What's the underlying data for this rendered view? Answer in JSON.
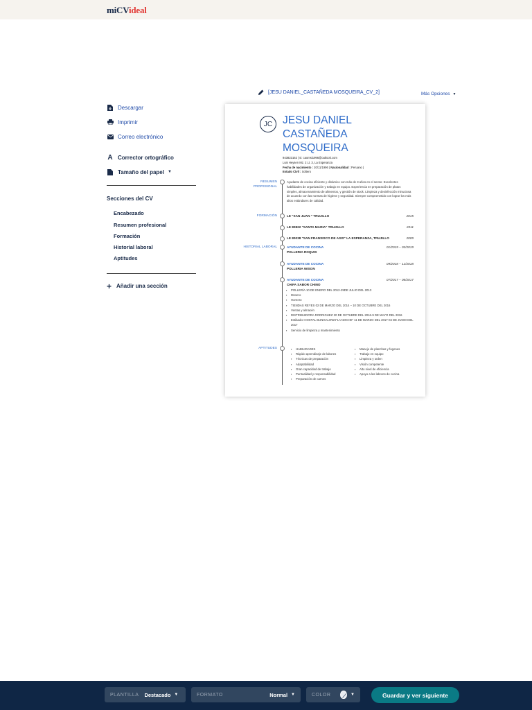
{
  "brand": {
    "logo_part1": "miCV",
    "logo_part2": "ideal"
  },
  "document": {
    "filename": "[JESU DANIEL_CASTAÑEDA MOSQUEIRA_CV_2]",
    "more_options": "Más Opciones"
  },
  "sidebar": {
    "actions": {
      "download": "Descargar",
      "print": "Imprimir",
      "email": "Correo electrónico",
      "spellcheck": "Corrector ortográfico",
      "paper_size": "Tamaño del papel"
    },
    "sections_title": "Secciones del CV",
    "sections": [
      "Encabezado",
      "Resumen profesional",
      "Formación",
      "Historial laboral",
      "Aptitudes"
    ],
    "add_section": "Añadir una sección"
  },
  "cv": {
    "initials": "JC",
    "name_line1": "JESU DANIEL",
    "name_line2": "CASTAÑEDA",
    "name_line3": "MOSQUEIRA",
    "contact": {
      "phone_email": "943823162 | E: caomsi1996@outlook.com",
      "address": "Luis Heysen Mz. 2 Lt. 3,  La Esperanza",
      "birth_label": "Fecha de nacimiento :",
      "birth_value": "20/11/1996 |",
      "nationality_label": "Nacionalidad :",
      "nationality_value": "Peruano |",
      "civil_label": "Estado Civil :",
      "civil_value": "Soltero"
    },
    "labels": {
      "summary": "RESUMEN PROFESIONAL",
      "education": "FORMACIÓN",
      "work": "HISTORIAL LABORAL",
      "skills": "APTITUDES"
    },
    "summary": "Ayudante de cocina eficiente y dinámico con más de 3 años en el sector. Excelentes habilidades de organización y trabajo en equipo. Experiencia en preparación de platos simples, almacenamiento de alimentos, y gestión de stock. Limpieza y desinfección minuciosa de acuerdo con las normas de higiene y seguridad. Siempre comprometido con lograr los más altos estándares de calidad.",
    "education": [
      {
        "title": "LE \"SAN JUAN \" TRUJILLO",
        "year": "2015"
      },
      {
        "title": "LE 80822 \"SANTA MARIA\" TRUJILLO",
        "year": "2011"
      },
      {
        "title": "LE 80038 \"SAN FRANSISCO DE ASIS\" LA ESPERANZA, TRUJILLO",
        "year": "2009"
      }
    ],
    "jobs": [
      {
        "title": "AYUDANTE DE COCINA",
        "company": "POLLERIA ROQUIS",
        "dates": "01/2019 – 03/2019"
      },
      {
        "title": "AYUDANTE DE COCINA",
        "company": "POLLERIA WISON",
        "dates": "09/2018 – 12/2018"
      },
      {
        "title": "AYUDANTE DE COCINA",
        "company": "CHIFA SABOR CHINO",
        "dates": "07/2017 – 08/2017"
      }
    ],
    "job_bullets": [
      "POLLERÍA 10 DE ENERO DEL 2012-29DE JULIO DEL 2013",
      "Mesero",
      "Hornero",
      "TIENDAS REYES 02 DE MARZO DEL 2014 – 10 DE OCTUBRE DEL 2016",
      "Ventas y almacén",
      "DISTRIBUIDORA RODRIGUEZ 20 DE OCTUBRE DEL 2016-9 DE MAYO DEL 2016",
      "Estibador HOSTAL BUNGALOWS\"LA NOCHE\" 11 DE MARZO DEL 2017-04 DE JUNIO DEL 2017",
      "Servicio de limpieza y mantenimiento"
    ],
    "skills_col1": [
      "HABILIDADES",
      "Rápido aprendizaje de labores",
      "Técnicas de preparación",
      "Adaptabilidad",
      "Gran capacidad de trabajo",
      "Puntualidad y responsabilidad",
      "Preparación de carnes"
    ],
    "skills_col2": [
      "Manejo de planchas y fogones",
      "Trabajo en equipo",
      "Limpieza y orden",
      "Visión competente",
      "Alto nivel de eficiencia",
      "Apoyo a las labores de cocina"
    ]
  },
  "toolbar": {
    "template_label": "PLANTILLA",
    "template_value": "Destacado",
    "format_label": "FORMATO",
    "format_value": "Normal",
    "color_label": "COLOR",
    "cta": "Guardar y ver siguiente"
  },
  "colors": {
    "accent": "#2f6cc9",
    "toolbar": "#0f2645",
    "cta": "#0a7a85",
    "brand_red": "#e23a36"
  }
}
